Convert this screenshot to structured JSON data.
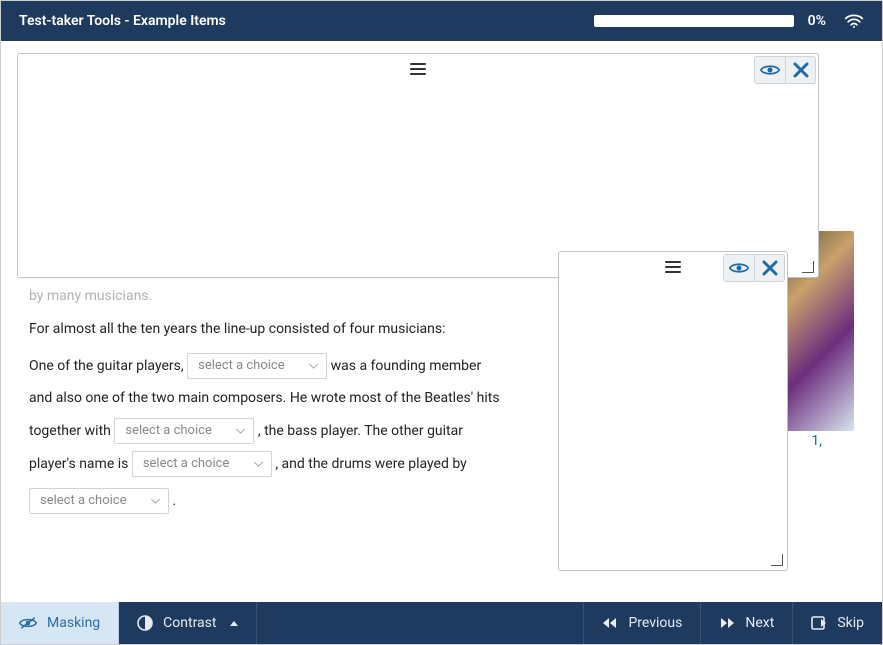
{
  "header": {
    "title": "Test-taker Tools - Example Items",
    "progress_pct": "0%"
  },
  "question": {
    "frag_top": "by many musicians.",
    "line1": "For almost all the ten years the line-up consisted of four musicians:",
    "seg_a": "One of the guitar players,",
    "seg_b": "was a founding member",
    "seg_c": "and also one of the two main composers. He wrote most of the Beatles' hits",
    "seg_d": "together with",
    "seg_e": ", the bass player. The other guitar",
    "seg_f": "player's name is",
    "seg_g": ", and the drums were played by",
    "period": ".",
    "select_placeholder": "select a choice",
    "caption_frag": "1,"
  },
  "footer": {
    "masking": "Masking",
    "contrast": "Contrast",
    "previous": "Previous",
    "next": "Next",
    "skip": "Skip"
  }
}
